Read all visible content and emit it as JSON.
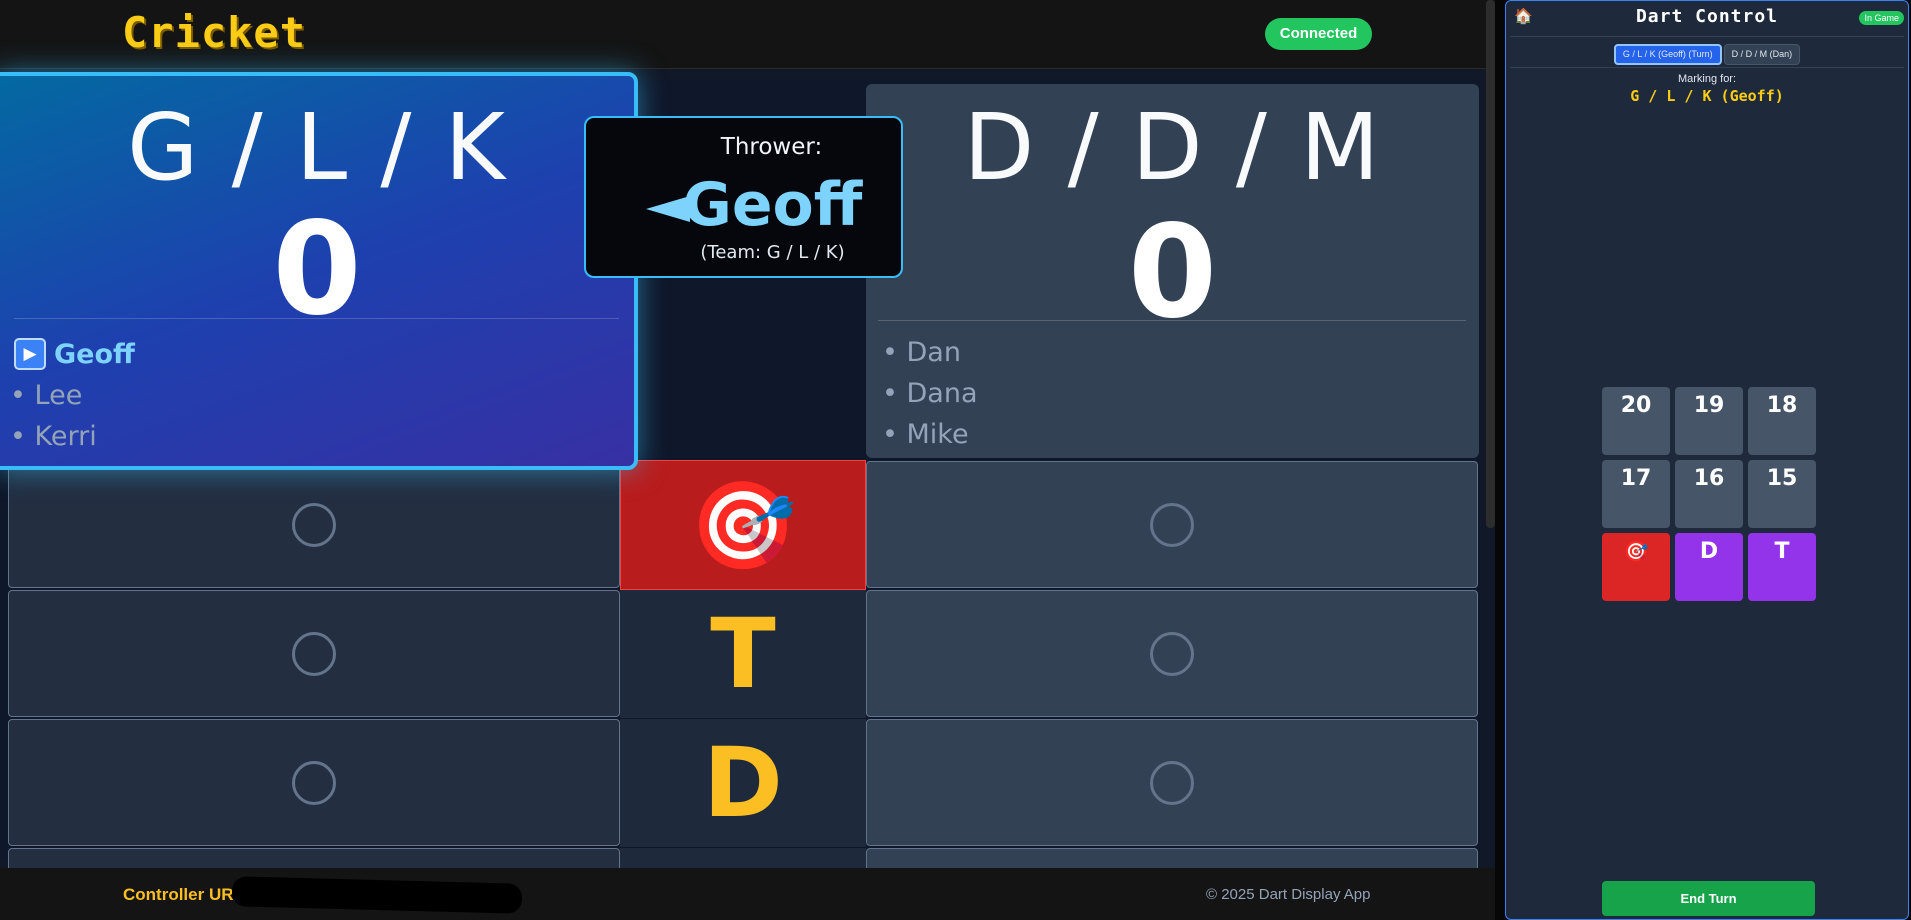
{
  "header": {
    "title": "Cricket",
    "status": "Connected"
  },
  "teams": [
    {
      "name": "G / L / K",
      "score": "0",
      "players": [
        {
          "name": "Geoff",
          "active": true
        },
        {
          "name": "• Lee"
        },
        {
          "name": "• Kerri"
        }
      ]
    },
    {
      "name": "D / D / M",
      "score": "0",
      "players": [
        {
          "name": "• Dan"
        },
        {
          "name": "• Dana"
        },
        {
          "name": "• Mike"
        }
      ]
    }
  ],
  "thrower": {
    "label": "Thrower:",
    "name": "Geoff",
    "team": "(Team: G / L / K)"
  },
  "rows": [
    {
      "label": "🎯",
      "icon": "bullseye-icon"
    },
    {
      "label": "T"
    },
    {
      "label": "D"
    }
  ],
  "footer": {
    "controller_label": "Controller URL",
    "copyright": "© 2025 Dart Display App"
  },
  "controller": {
    "title": "Dart Control",
    "home_icon": "🏠",
    "badge": "In Game",
    "tabs": [
      {
        "label": "G / L / K (Geoff) (Turn)",
        "selected": true
      },
      {
        "label": "D / D / M (Dan)"
      }
    ],
    "marking_label": "Marking for:",
    "marking_team": "G / L / K (Geoff)",
    "keys": [
      "20",
      "19",
      "18",
      "17",
      "16",
      "15",
      "🎯",
      "D",
      "T"
    ],
    "end_turn": "End Turn"
  },
  "colors": {
    "accent": "#38bdf8",
    "gold": "#fbbf24",
    "bull": "#b91c1c",
    "connected": "#22c55e",
    "multiplier": "#9333ea"
  }
}
